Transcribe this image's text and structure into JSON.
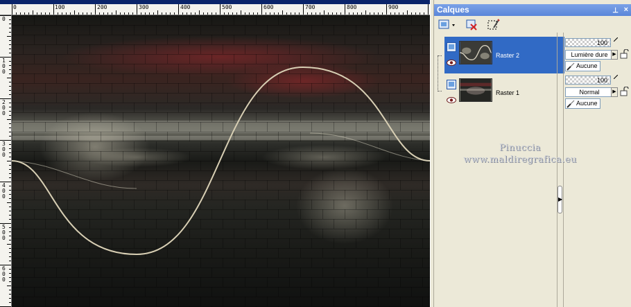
{
  "ruler": {
    "top_labels": [
      "0",
      "100",
      "200",
      "300",
      "400",
      "500",
      "600",
      "700",
      "800",
      "900"
    ],
    "left_labels": [
      "0",
      "100",
      "200",
      "300",
      "400",
      "500",
      "600"
    ]
  },
  "watermark": {
    "line1": "Pinuccia",
    "line2": "www.maldiregrafica.eu"
  },
  "panel": {
    "title": "Calques",
    "pin": "⊥",
    "close": "×"
  },
  "layers": [
    {
      "name": "Raster 2",
      "selected": true,
      "opacity": "100",
      "blend_mode": "Lumière dure",
      "mask": "Aucune"
    },
    {
      "name": "Raster 1",
      "selected": false,
      "opacity": "100",
      "blend_mode": "Normal",
      "mask": "Aucune"
    }
  ],
  "colors": {
    "selection": "#316ac5",
    "panel_bg": "#ece9d8",
    "titlebar": "#5a86d9",
    "curve": "#d8cfb4"
  }
}
